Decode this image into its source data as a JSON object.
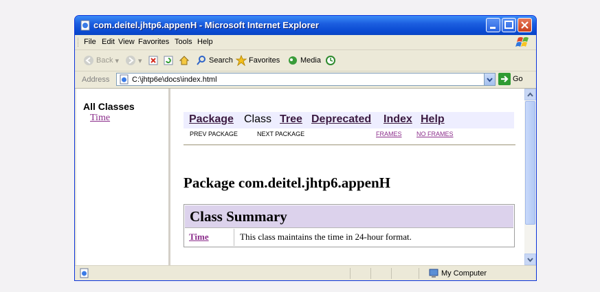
{
  "window": {
    "title": "com.deitel.jhtp6.appenH - Microsoft Internet Explorer"
  },
  "menu": [
    "File",
    "Edit",
    "View",
    "Favorites",
    "Tools",
    "Help"
  ],
  "toolbar": {
    "back_label": "Back",
    "search_label": "Search",
    "favorites_label": "Favorites",
    "media_label": "Media"
  },
  "address": {
    "label": "Address",
    "url": "C:\\jhtp6e\\docs\\index.html",
    "go_label": "Go"
  },
  "left_frame": {
    "heading": "All Classes",
    "classes": [
      "Time"
    ]
  },
  "right_frame": {
    "nav": {
      "package": "Package",
      "class": "Class",
      "tree": "Tree",
      "deprecated": "Deprecated",
      "index": "Index",
      "help": "Help"
    },
    "subnav": {
      "prev_package": "PREV PACKAGE",
      "next_package": "NEXT PACKAGE",
      "frames": "FRAMES",
      "no_frames": "NO FRAMES"
    },
    "package_title": "Package com.deitel.jhtp6.appenH",
    "class_summary": {
      "heading": "Class Summary",
      "rows": [
        {
          "name": "Time",
          "description": "This class maintains the time in 24-hour format."
        }
      ]
    }
  },
  "status": {
    "zone": "My Computer"
  }
}
